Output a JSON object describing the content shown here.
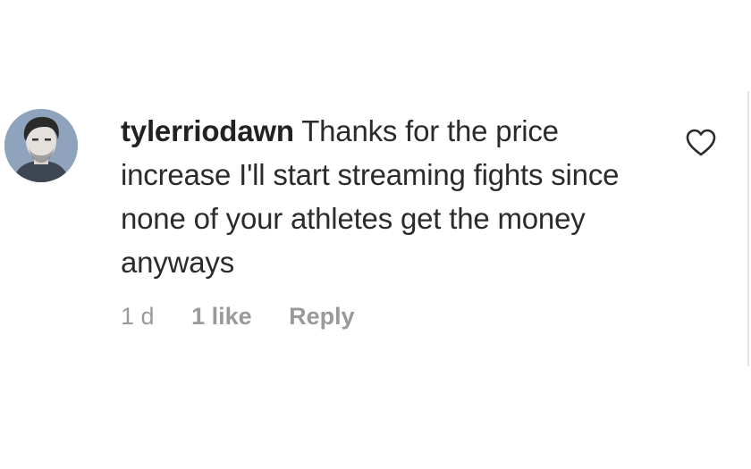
{
  "comment": {
    "username": "tylerriodawn",
    "text": "Thanks for the price increase I'll start streaming fights since none of your athletes get the money anyways",
    "time": "1 d",
    "likes": "1 like",
    "reply_label": "Reply",
    "avatar_icon": "user-avatar",
    "like_icon": "heart-outline-icon"
  },
  "colors": {
    "text": "#2b2b2b",
    "meta": "#9a9a9a",
    "background": "#ffffff"
  }
}
